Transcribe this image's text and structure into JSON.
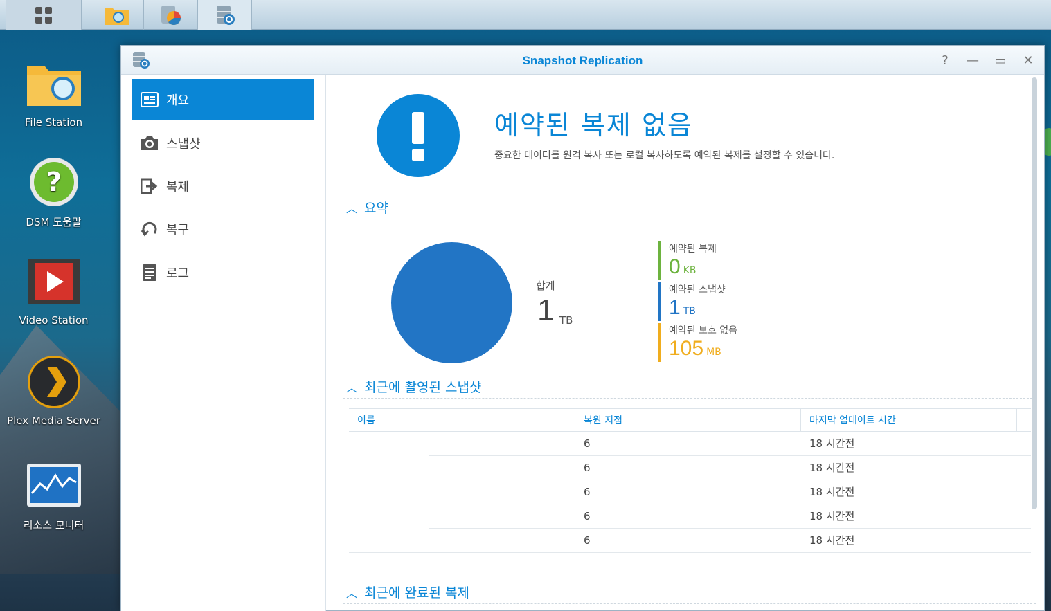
{
  "taskbar": {
    "buttons": [
      "main-menu",
      "file-station",
      "storage-manager",
      "snapshot-replication"
    ]
  },
  "desktop": {
    "icons": [
      {
        "label": "File Station"
      },
      {
        "label": "DSM 도움말"
      },
      {
        "label": "Video Station"
      },
      {
        "label": "Plex Media Server"
      },
      {
        "label": "리소스 모니터"
      }
    ]
  },
  "window": {
    "title": "Snapshot Replication",
    "controls": {
      "help": "?",
      "minimize": "—",
      "maximize": "▭",
      "close": "✕"
    }
  },
  "sidebar": {
    "items": [
      {
        "label": "개요",
        "icon": "overview-icon",
        "active": true
      },
      {
        "label": "스냅샷",
        "icon": "camera-icon",
        "active": false
      },
      {
        "label": "복제",
        "icon": "replication-icon",
        "active": false
      },
      {
        "label": "복구",
        "icon": "recovery-icon",
        "active": false
      },
      {
        "label": "로그",
        "icon": "log-icon",
        "active": false
      }
    ]
  },
  "overview": {
    "headline": "예약된 복제 없음",
    "subline": "중요한 데이터를 원격 복사 또는 로컬 복사하도록 예약된 복제를 설정할 수 있습니다."
  },
  "summary": {
    "section_title": "요약",
    "total_label": "합계",
    "total_value": "1",
    "total_unit": "TB",
    "stats": [
      {
        "label": "예약된 복제",
        "value": "0",
        "unit": "KB",
        "color": "#6db33f"
      },
      {
        "label": "예약된 스냅샷",
        "value": "1",
        "unit": "TB",
        "color": "#2275c5"
      },
      {
        "label": "예약된 보호 없음",
        "value": "105",
        "unit": "MB",
        "color": "#f0ad1e"
      }
    ]
  },
  "recent_snapshots": {
    "section_title": "최근에 촬영된 스냅샷",
    "columns": [
      "이름",
      "복원 지점",
      "마지막 업데이트 시간"
    ],
    "rows": [
      {
        "name": "",
        "restore_points": "6",
        "updated": "18 시간전"
      },
      {
        "name": "",
        "restore_points": "6",
        "updated": "18 시간전"
      },
      {
        "name": "",
        "restore_points": "6",
        "updated": "18 시간전"
      },
      {
        "name": "",
        "restore_points": "6",
        "updated": "18 시간전"
      },
      {
        "name": "",
        "restore_points": "6",
        "updated": "18 시간전"
      }
    ]
  },
  "recent_replications": {
    "section_title": "최근에 완료된 복제"
  },
  "colors": {
    "accent": "#0a86d6",
    "chart_blue": "#2275c5"
  }
}
